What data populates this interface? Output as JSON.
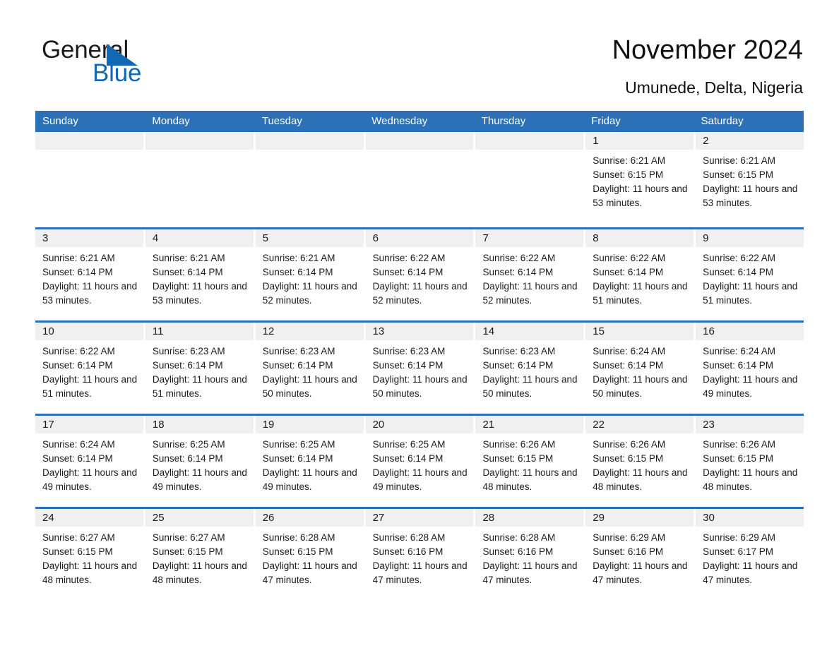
{
  "brand": {
    "name_part1": "General",
    "name_part2": "Blue",
    "triangle_icon": "triangle-icon",
    "accent_color": "#1268b3"
  },
  "header": {
    "title": "November 2024",
    "location": "Umunede, Delta, Nigeria",
    "header_bg_color": "#2c71b8"
  },
  "calendar": {
    "weekdays": [
      "Sunday",
      "Monday",
      "Tuesday",
      "Wednesday",
      "Thursday",
      "Friday",
      "Saturday"
    ],
    "weeks": [
      [
        {
          "day": "",
          "empty": true
        },
        {
          "day": "",
          "empty": true
        },
        {
          "day": "",
          "empty": true
        },
        {
          "day": "",
          "empty": true
        },
        {
          "day": "",
          "empty": true
        },
        {
          "day": "1",
          "sunrise": "Sunrise: 6:21 AM",
          "sunset": "Sunset: 6:15 PM",
          "daylight": "Daylight: 11 hours and 53 minutes."
        },
        {
          "day": "2",
          "sunrise": "Sunrise: 6:21 AM",
          "sunset": "Sunset: 6:15 PM",
          "daylight": "Daylight: 11 hours and 53 minutes."
        }
      ],
      [
        {
          "day": "3",
          "sunrise": "Sunrise: 6:21 AM",
          "sunset": "Sunset: 6:14 PM",
          "daylight": "Daylight: 11 hours and 53 minutes."
        },
        {
          "day": "4",
          "sunrise": "Sunrise: 6:21 AM",
          "sunset": "Sunset: 6:14 PM",
          "daylight": "Daylight: 11 hours and 53 minutes."
        },
        {
          "day": "5",
          "sunrise": "Sunrise: 6:21 AM",
          "sunset": "Sunset: 6:14 PM",
          "daylight": "Daylight: 11 hours and 52 minutes."
        },
        {
          "day": "6",
          "sunrise": "Sunrise: 6:22 AM",
          "sunset": "Sunset: 6:14 PM",
          "daylight": "Daylight: 11 hours and 52 minutes."
        },
        {
          "day": "7",
          "sunrise": "Sunrise: 6:22 AM",
          "sunset": "Sunset: 6:14 PM",
          "daylight": "Daylight: 11 hours and 52 minutes."
        },
        {
          "day": "8",
          "sunrise": "Sunrise: 6:22 AM",
          "sunset": "Sunset: 6:14 PM",
          "daylight": "Daylight: 11 hours and 51 minutes."
        },
        {
          "day": "9",
          "sunrise": "Sunrise: 6:22 AM",
          "sunset": "Sunset: 6:14 PM",
          "daylight": "Daylight: 11 hours and 51 minutes."
        }
      ],
      [
        {
          "day": "10",
          "sunrise": "Sunrise: 6:22 AM",
          "sunset": "Sunset: 6:14 PM",
          "daylight": "Daylight: 11 hours and 51 minutes."
        },
        {
          "day": "11",
          "sunrise": "Sunrise: 6:23 AM",
          "sunset": "Sunset: 6:14 PM",
          "daylight": "Daylight: 11 hours and 51 minutes."
        },
        {
          "day": "12",
          "sunrise": "Sunrise: 6:23 AM",
          "sunset": "Sunset: 6:14 PM",
          "daylight": "Daylight: 11 hours and 50 minutes."
        },
        {
          "day": "13",
          "sunrise": "Sunrise: 6:23 AM",
          "sunset": "Sunset: 6:14 PM",
          "daylight": "Daylight: 11 hours and 50 minutes."
        },
        {
          "day": "14",
          "sunrise": "Sunrise: 6:23 AM",
          "sunset": "Sunset: 6:14 PM",
          "daylight": "Daylight: 11 hours and 50 minutes."
        },
        {
          "day": "15",
          "sunrise": "Sunrise: 6:24 AM",
          "sunset": "Sunset: 6:14 PM",
          "daylight": "Daylight: 11 hours and 50 minutes."
        },
        {
          "day": "16",
          "sunrise": "Sunrise: 6:24 AM",
          "sunset": "Sunset: 6:14 PM",
          "daylight": "Daylight: 11 hours and 49 minutes."
        }
      ],
      [
        {
          "day": "17",
          "sunrise": "Sunrise: 6:24 AM",
          "sunset": "Sunset: 6:14 PM",
          "daylight": "Daylight: 11 hours and 49 minutes."
        },
        {
          "day": "18",
          "sunrise": "Sunrise: 6:25 AM",
          "sunset": "Sunset: 6:14 PM",
          "daylight": "Daylight: 11 hours and 49 minutes."
        },
        {
          "day": "19",
          "sunrise": "Sunrise: 6:25 AM",
          "sunset": "Sunset: 6:14 PM",
          "daylight": "Daylight: 11 hours and 49 minutes."
        },
        {
          "day": "20",
          "sunrise": "Sunrise: 6:25 AM",
          "sunset": "Sunset: 6:14 PM",
          "daylight": "Daylight: 11 hours and 49 minutes."
        },
        {
          "day": "21",
          "sunrise": "Sunrise: 6:26 AM",
          "sunset": "Sunset: 6:15 PM",
          "daylight": "Daylight: 11 hours and 48 minutes."
        },
        {
          "day": "22",
          "sunrise": "Sunrise: 6:26 AM",
          "sunset": "Sunset: 6:15 PM",
          "daylight": "Daylight: 11 hours and 48 minutes."
        },
        {
          "day": "23",
          "sunrise": "Sunrise: 6:26 AM",
          "sunset": "Sunset: 6:15 PM",
          "daylight": "Daylight: 11 hours and 48 minutes."
        }
      ],
      [
        {
          "day": "24",
          "sunrise": "Sunrise: 6:27 AM",
          "sunset": "Sunset: 6:15 PM",
          "daylight": "Daylight: 11 hours and 48 minutes."
        },
        {
          "day": "25",
          "sunrise": "Sunrise: 6:27 AM",
          "sunset": "Sunset: 6:15 PM",
          "daylight": "Daylight: 11 hours and 48 minutes."
        },
        {
          "day": "26",
          "sunrise": "Sunrise: 6:28 AM",
          "sunset": "Sunset: 6:15 PM",
          "daylight": "Daylight: 11 hours and 47 minutes."
        },
        {
          "day": "27",
          "sunrise": "Sunrise: 6:28 AM",
          "sunset": "Sunset: 6:16 PM",
          "daylight": "Daylight: 11 hours and 47 minutes."
        },
        {
          "day": "28",
          "sunrise": "Sunrise: 6:28 AM",
          "sunset": "Sunset: 6:16 PM",
          "daylight": "Daylight: 11 hours and 47 minutes."
        },
        {
          "day": "29",
          "sunrise": "Sunrise: 6:29 AM",
          "sunset": "Sunset: 6:16 PM",
          "daylight": "Daylight: 11 hours and 47 minutes."
        },
        {
          "day": "30",
          "sunrise": "Sunrise: 6:29 AM",
          "sunset": "Sunset: 6:17 PM",
          "daylight": "Daylight: 11 hours and 47 minutes."
        }
      ]
    ]
  }
}
